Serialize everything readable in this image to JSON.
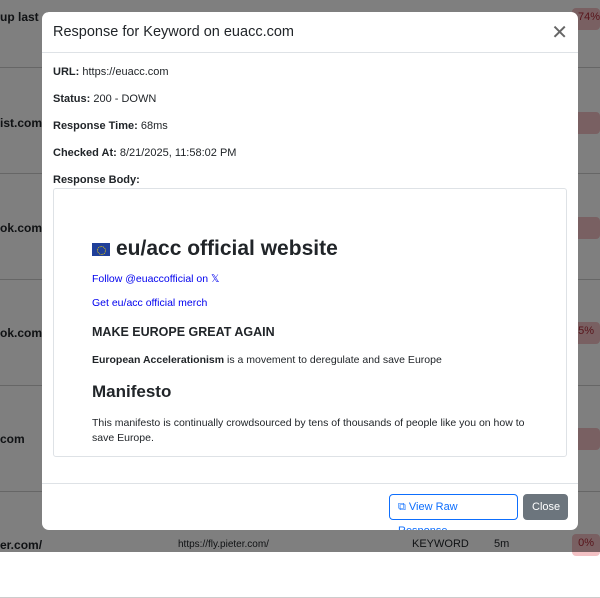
{
  "background": {
    "rows": [
      {
        "name": "up last d",
        "badge": "74%"
      },
      {
        "name": "ist.com",
        "badge": ""
      },
      {
        "name": "ok.com",
        "badge": ""
      },
      {
        "name": "ok.com/l",
        "badge": "5%"
      },
      {
        "name": "com",
        "badge": ""
      },
      {
        "name": "er.com/",
        "url": "https://fly.pieter.com/",
        "type": "KEYWORD",
        "interval": "5m",
        "badge": "0%"
      }
    ]
  },
  "modal": {
    "title": "Response for Keyword on euacc.com",
    "fields": [
      {
        "label": "URL:",
        "value": "https://euacc.com"
      },
      {
        "label": "Status:",
        "value": "200 - DOWN"
      },
      {
        "label": "Response Time:",
        "value": "68ms"
      },
      {
        "label": "Checked At:",
        "value": "8/21/2025, 11:58:02 PM"
      }
    ],
    "body_label": "Response Body:",
    "body": {
      "heading": "eu/acc official website",
      "link1": "Follow @euaccofficial on 𝕏",
      "link2": "Get eu/acc official merch",
      "subheading": "MAKE EUROPE GREAT AGAIN",
      "para_bold": "European Accelerationism",
      "para_rest": " is a movement to deregulate and save Europe",
      "h2": "Manifesto",
      "para2": "This manifesto is continually crowdsourced by tens of thousands of people like you on how to save Europe."
    },
    "raw_button": "View Raw Response",
    "close_button": "Close"
  }
}
